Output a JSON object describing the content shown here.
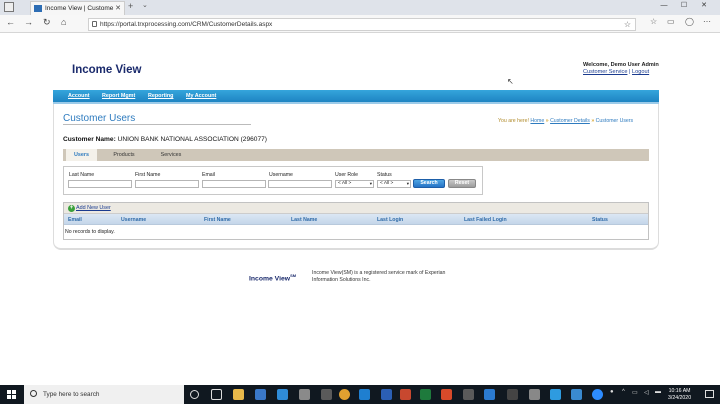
{
  "browser": {
    "tab_title": "Income View | Custome",
    "url": "https://portal.trxprocessing.com/CRM/CustomerDetails.aspx"
  },
  "header": {
    "logo": "Income View",
    "welcome": "Welcome, Demo User Admin",
    "customer_service": "Customer Service",
    "separator": "|",
    "logout": "Logout"
  },
  "menu": {
    "items": [
      "Account",
      "Report Mgmt",
      "Reporting",
      "My Account"
    ]
  },
  "page": {
    "title": "Customer Users",
    "breadcrumb": {
      "prefix": "You are here!",
      "home": "Home",
      "details": "Customer Details",
      "current": "Customer Users",
      "arrow": "»"
    },
    "customer_label": "Customer Name:",
    "customer_name": "UNION BANK NATIONAL ASSOCIATION (296077)"
  },
  "tabs": [
    "Users",
    "Products",
    "Services"
  ],
  "filters": {
    "last_name": "Last Name",
    "first_name": "First Name",
    "email": "Email",
    "username": "Username",
    "user_role": "User Role",
    "status": "Status",
    "role_value": "< All >",
    "status_value": "< All >",
    "search_button": "Search",
    "reset_button": "Reset"
  },
  "grid": {
    "add_new_user": "Add New User",
    "columns": [
      "Email",
      "Username",
      "First Name",
      "Last Name",
      "Last Login",
      "Last Failed Login",
      "Status"
    ],
    "empty_text": "No records to display."
  },
  "footer": {
    "logo": "Income View",
    "tm": "SM",
    "text": "Income View(SM) is a registered service mark of Experian Information Solutions Inc."
  },
  "taskbar": {
    "search_placeholder": "Type here to search",
    "time": "10:16 AM",
    "date": "3/24/2020"
  }
}
